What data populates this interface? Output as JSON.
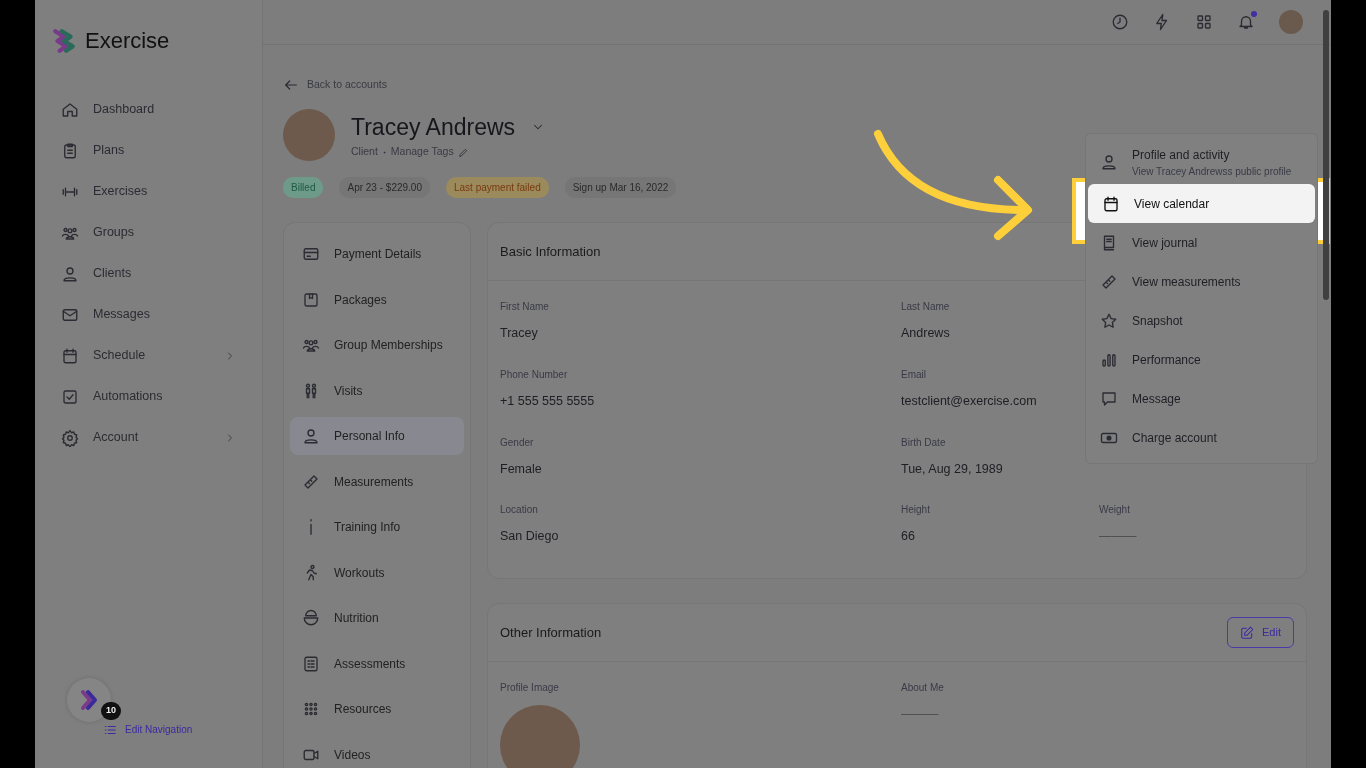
{
  "brand": {
    "name": "Exercise"
  },
  "sidebar": {
    "items": [
      {
        "label": "Dashboard",
        "has_submenu": false
      },
      {
        "label": "Plans",
        "has_submenu": false
      },
      {
        "label": "Exercises",
        "has_submenu": false
      },
      {
        "label": "Groups",
        "has_submenu": false
      },
      {
        "label": "Clients",
        "has_submenu": false
      },
      {
        "label": "Messages",
        "has_submenu": false
      },
      {
        "label": "Schedule",
        "has_submenu": true
      },
      {
        "label": "Automations",
        "has_submenu": false
      },
      {
        "label": "Account",
        "has_submenu": true
      }
    ],
    "nav_badge": "10",
    "edit_navigation": "Edit Navigation"
  },
  "topbar": {
    "notifications_unread": true
  },
  "back_link": "Back to accounts",
  "profile": {
    "name": "Tracey Andrews",
    "role": "Client",
    "manage_tags": "Manage Tags"
  },
  "tags": [
    {
      "label": "Billed",
      "kind": "success"
    },
    {
      "label": "Apr 23 - $229.00",
      "kind": "neutral"
    },
    {
      "label": "Last payment failed",
      "kind": "warning"
    },
    {
      "label": "Sign up Mar 16, 2022",
      "kind": "neutral"
    }
  ],
  "sections": [
    {
      "label": "Payment Details",
      "selected": false
    },
    {
      "label": "Packages",
      "selected": false
    },
    {
      "label": "Group Memberships",
      "selected": false
    },
    {
      "label": "Visits",
      "selected": false
    },
    {
      "label": "Personal Info",
      "selected": true
    },
    {
      "label": "Measurements",
      "selected": false
    },
    {
      "label": "Training Info",
      "selected": false
    },
    {
      "label": "Workouts",
      "selected": false
    },
    {
      "label": "Nutrition",
      "selected": false
    },
    {
      "label": "Assessments",
      "selected": false
    },
    {
      "label": "Resources",
      "selected": false
    },
    {
      "label": "Videos",
      "selected": false
    }
  ],
  "basic_information": {
    "title": "Basic Information",
    "rows": [
      [
        {
          "label": "First Name",
          "value": "Tracey"
        },
        {
          "label": "Last Name",
          "value": "Andrews"
        }
      ],
      [
        {
          "label": "Phone Number",
          "value": "+1 555 555 5555"
        },
        {
          "label": "Email",
          "value": "testclient@exercise.com"
        }
      ],
      [
        {
          "label": "Gender",
          "value": "Female"
        },
        {
          "label": "Birth Date",
          "value": "Tue, Aug 29, 1989"
        }
      ],
      [
        {
          "label": "Location",
          "value": "San Diego"
        },
        {
          "label": "Height",
          "value": "66"
        },
        {
          "label": "Weight",
          "value": "———"
        }
      ]
    ]
  },
  "other_information": {
    "title": "Other Information",
    "edit_button": "Edit",
    "fields": [
      {
        "label": "Profile Image",
        "kind": "image"
      },
      {
        "label": "About Me",
        "kind": "text",
        "value": "———"
      }
    ]
  },
  "menu": {
    "items": [
      {
        "label": "Profile and activity",
        "subtitle": "View Tracey Andrewss public profile",
        "selected": false
      },
      {
        "label": "View calendar",
        "selected": true
      },
      {
        "label": "View journal",
        "selected": false
      },
      {
        "label": "View measurements",
        "selected": false
      },
      {
        "label": "Snapshot",
        "selected": false
      },
      {
        "label": "Performance",
        "selected": false
      },
      {
        "label": "Message",
        "selected": false
      },
      {
        "label": "Charge account",
        "selected": false
      }
    ]
  }
}
